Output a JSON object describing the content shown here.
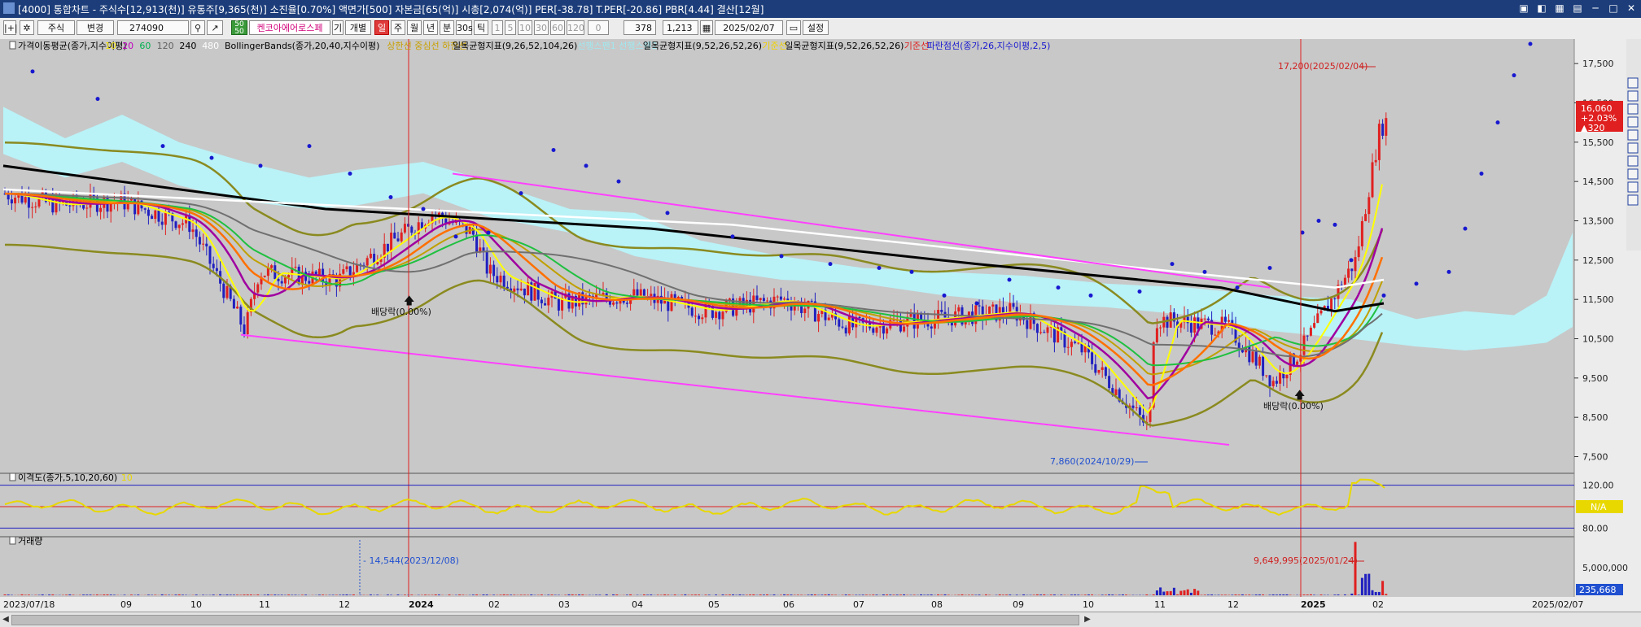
{
  "window": {
    "title": "[4000] 통합차트 - 주식수[12,913(천)] 유통주[9,365(천)] 소진율[0.70%] 액면가[500] 자본금[65(억)] 시총[2,074(억)] PER[-38.78] T.PER[-20.86] PBR[4.44] 결산[12월]"
  },
  "toolbar": {
    "market": "주식",
    "change": "변경",
    "code": "274090",
    "name": "켄코아에어로스페",
    "buttons": [
      "기",
      "개별",
      "일",
      "주",
      "월",
      "년",
      "분",
      "30s",
      "틱"
    ],
    "periods": [
      "1",
      "5",
      "10",
      "30",
      "60",
      "120"
    ],
    "count": "378",
    "ratio": "1,213",
    "date": "2025/02/07",
    "settings": "설정"
  },
  "legend_price": [
    {
      "text": "가격이동평균(종가,지수이평)",
      "color": "#000000"
    },
    {
      "text": "10",
      "color": "#f0e000"
    },
    {
      "text": "20",
      "color": "#c000c0"
    },
    {
      "text": "60",
      "color": "#00b050"
    },
    {
      "text": "120",
      "color": "#606060"
    },
    {
      "text": "240",
      "color": "#000000"
    },
    {
      "text": "480",
      "color": "#ffffff"
    },
    {
      "text": "BollingerBands(종가,20,40,지수이평)",
      "color": "#000000"
    },
    {
      "text": "상한선 중심선 하한선",
      "color": "#c8a000"
    },
    {
      "text": "일목균형지표(9,26,52,104,26)",
      "color": "#000000"
    },
    {
      "text": "선행스팬1 선행스팬2",
      "color": "#a0e8f0"
    },
    {
      "text": "일목균형지표(9,52,26,52,26)",
      "color": "#000000"
    },
    {
      "text": "기준선",
      "color": "#f0d000"
    },
    {
      "text": "일목균형지표(9,52,26,52,26)",
      "color": "#000000"
    },
    {
      "text": "기준선",
      "color": "#e02020"
    },
    {
      "text": "파란점선(종가,26,지수이평,2,5)",
      "color": "#1818d0"
    }
  ],
  "legend_disparity": [
    {
      "text": "이격도(종가,5,10,20,60)",
      "color": "#000000"
    },
    {
      "text": "10",
      "color": "#e8d800"
    }
  ],
  "legend_volume": [
    {
      "text": "거래량",
      "color": "#000000"
    }
  ],
  "annotations": {
    "high": "17,200(2025/02/04)",
    "low": "7,860(2024/10/29)",
    "div1": "배당락(0.00%)",
    "div2": "배당락(0.00%)",
    "vol_high": "9,649,995(2025/01/24)",
    "vol_low": "14,544(2023/12/08)"
  },
  "price_badge": {
    "price": "16,060",
    "change_pct": "+2.03%",
    "change": "▲320"
  },
  "disparity_badge": "N/A",
  "volume_badge": "235,668",
  "colors": {
    "background": "#c8c8c8",
    "up": "#e02020",
    "down": "#2020c0",
    "ichimoku_cloud": "#b8f4fa",
    "trend_line": "#ff40ff",
    "blue_dots": "#1818d0",
    "bollinger": "#8a8a20"
  },
  "chart_data": [
    {
      "type": "candlestick",
      "title": "",
      "x_ticks": [
        "2023/07/18",
        "09",
        "10",
        "11",
        "12",
        "2024",
        "02",
        "03",
        "04",
        "05",
        "06",
        "07",
        "08",
        "09",
        "10",
        "11",
        "12",
        "2025",
        "02",
        "2025/02/07"
      ],
      "y_ticks": [
        17500,
        16500,
        15500,
        14500,
        13500,
        12500,
        11500,
        10500,
        9500,
        8500,
        7500
      ],
      "ylim": [
        7200,
        18000
      ],
      "y_tick_labels": [
        "17,500",
        "16,500",
        "15,500",
        "14,500",
        "13,500",
        "12,500",
        "11,500",
        "10,500",
        "9,500",
        "8,500",
        "7,500"
      ],
      "close_approx": [
        {
          "x": "2023/07",
          "y": 14200
        },
        {
          "x": "2023/08",
          "y": 13900
        },
        {
          "x": "2023/09",
          "y": 14000
        },
        {
          "x": "2023/10",
          "y": 13400
        },
        {
          "x": "2023/10/25",
          "y": 10700
        },
        {
          "x": "2023/11",
          "y": 12200
        },
        {
          "x": "2023/12",
          "y": 12000
        },
        {
          "x": "2024/01/10",
          "y": 13700
        },
        {
          "x": "2024/01/25",
          "y": 13200
        },
        {
          "x": "2024/02",
          "y": 12200
        },
        {
          "x": "2024/03",
          "y": 11400
        },
        {
          "x": "2024/04",
          "y": 11600
        },
        {
          "x": "2024/05",
          "y": 11200
        },
        {
          "x": "2024/06",
          "y": 11500
        },
        {
          "x": "2024/07",
          "y": 10800
        },
        {
          "x": "2024/08",
          "y": 11000
        },
        {
          "x": "2024/09",
          "y": 11200
        },
        {
          "x": "2024/10",
          "y": 10200
        },
        {
          "x": "2024/10/29",
          "y": 8200
        },
        {
          "x": "2024/11",
          "y": 11000
        },
        {
          "x": "2024/12",
          "y": 10800
        },
        {
          "x": "2024/12/20",
          "y": 9400
        },
        {
          "x": "2025/01",
          "y": 10200
        },
        {
          "x": "2025/01/24",
          "y": 12500
        },
        {
          "x": "2025/02/04",
          "y": 15800
        },
        {
          "x": "2025/02/07",
          "y": 16060
        }
      ],
      "high": {
        "date": "2025/02/04",
        "value": 17200
      },
      "low": {
        "date": "2024/10/29",
        "value": 7860
      }
    },
    {
      "type": "line",
      "title": "",
      "y_ticks": [
        120,
        100,
        80
      ],
      "y_tick_labels": [
        "120.00",
        "100.00",
        "80.00"
      ],
      "reference_lines": [
        120,
        100,
        80
      ]
    },
    {
      "type": "bar",
      "title": "",
      "y_ticks": [
        5000000
      ],
      "y_tick_labels": [
        "5,000,000"
      ],
      "max": {
        "date": "2025/01/24",
        "value": 9649995
      },
      "min": {
        "date": "2023/12/08",
        "value": 14544
      },
      "last": 235668
    }
  ]
}
